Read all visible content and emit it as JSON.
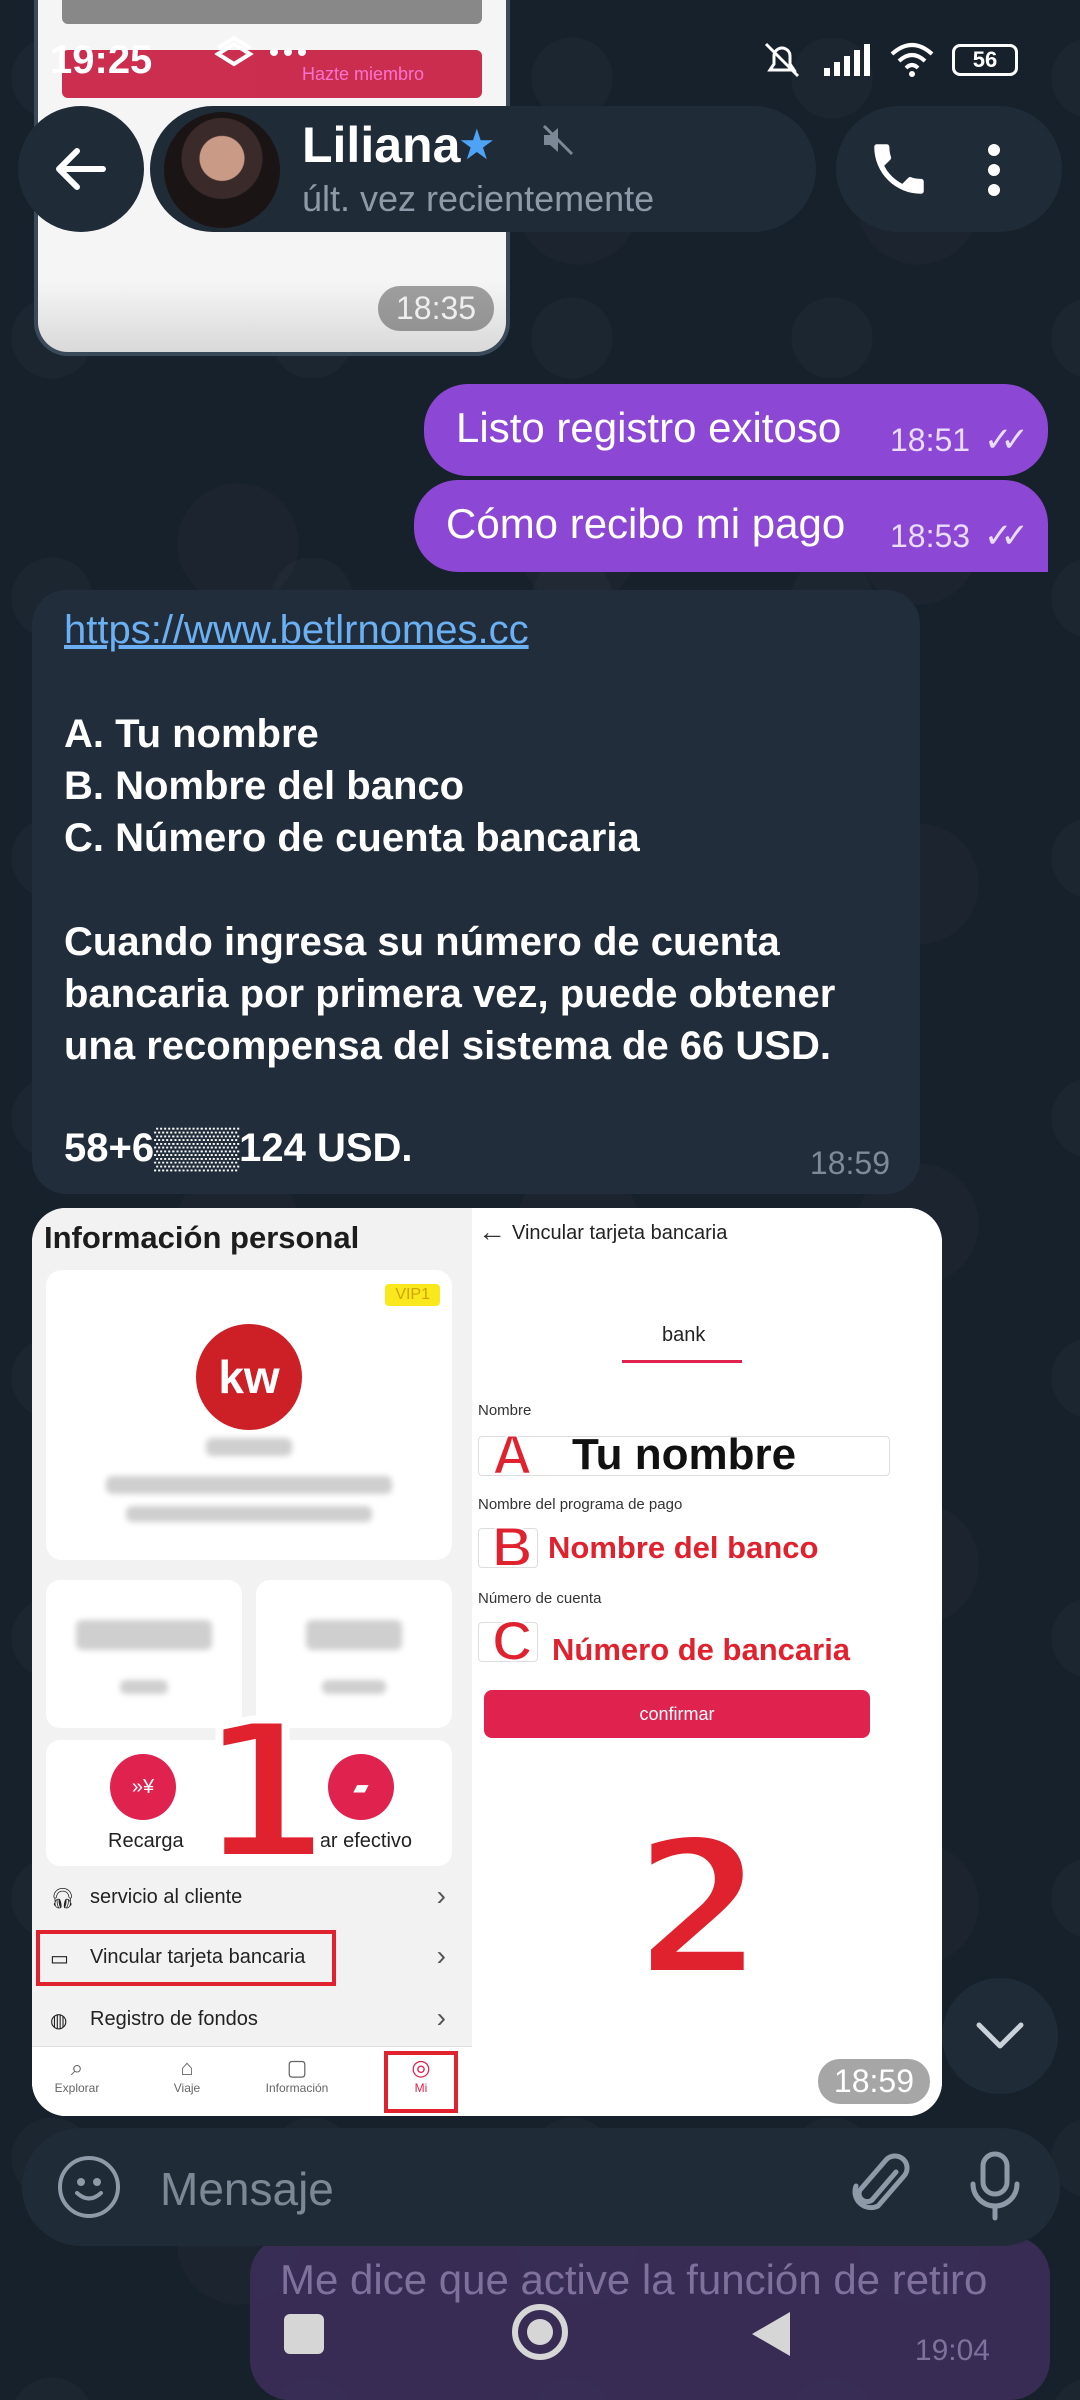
{
  "status_bar": {
    "time": "19:25",
    "dots": "···",
    "battery": "56"
  },
  "prev_card": {
    "button_text": "Hazte miembro",
    "time": "18:35"
  },
  "header": {
    "name": "Liliana",
    "last_seen": "últ. vez recientemente"
  },
  "messages": {
    "out1": {
      "text": "Listo registro exitoso",
      "time": "18:51"
    },
    "out2": {
      "text": "Cómo recibo mi pago",
      "time": "18:53"
    },
    "in1": {
      "link": "https://www.betlrnomes.cc",
      "lines": [
        "A. Tu nombre",
        "B. Nombre del banco",
        "C. Número de cuenta bancaria",
        "Cuando ingresa su número de cuenta",
        "bancaria por primera vez, puede obtener",
        "una recompensa del sistema de 66  USD.",
        "58+6▒▒▒124  USD."
      ],
      "time": "18:59"
    },
    "image": {
      "time": "18:59",
      "left": {
        "title": "Información personal",
        "vip": "VIP1",
        "logo": "kw",
        "recharge": "Recarga",
        "withdraw": "etirar efectivo",
        "rows": [
          "servicio al cliente",
          "Vincular tarjeta bancaria",
          "Registro de fondos"
        ],
        "nav": [
          "Explorar",
          "Viaje",
          "Información",
          "Mi"
        ],
        "big_number": "1"
      },
      "right": {
        "title": "Vincular tarjeta bancaria",
        "tab": "bank",
        "label_name": "Nombre",
        "label_bank": "Nombre del programa de pago",
        "label_account": "Número de cuenta",
        "overlay_a": "Tu nombre",
        "overlay_b": "Nombre del banco",
        "overlay_c": "Número de bancaria",
        "letter_a": "A",
        "letter_b": "B",
        "letter_c": "C",
        "confirm": "confirmar",
        "big_number": "2"
      }
    },
    "out3": {
      "text": "Me dice que active la función de retiro",
      "time": "19:04"
    }
  },
  "input": {
    "placeholder": "Mensaje"
  },
  "colors": {
    "accent": "#8c48d4",
    "bg": "#17212b",
    "red": "#e0222f",
    "link": "#6ab0f3"
  }
}
